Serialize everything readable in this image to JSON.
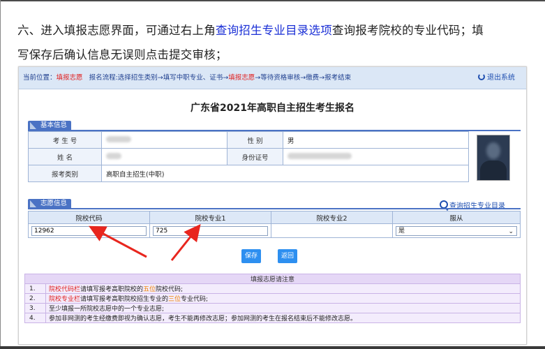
{
  "instruction": {
    "line1_a": "六、进入填报志愿界面，可通过右上角",
    "line1_link": "查询招生专业目录选项",
    "line1_b": "查询报考院校的专业代码；填",
    "line2": "写保存后确认信息无误则点击提交审核；"
  },
  "topbar": {
    "location_label": "当前位置：",
    "location_value": "填报志愿",
    "flow_a": "报名流程:选择招生类别→填写中职专业、证书→",
    "flow_current": "填报志愿",
    "flow_b": "→等待资格审核→缴费→报考结束",
    "logout": "退出系统"
  },
  "title": "广东省2021年高职自主招生考生报名",
  "basic": {
    "tab": "基本信息",
    "exam_no_label": "考 生 号",
    "gender_label": "性    别",
    "gender_value": "男",
    "name_label": "姓    名",
    "id_label": "身份证号",
    "category_label": "报考类别",
    "category_value": "高职自主招生(中职)"
  },
  "volunteer": {
    "tab": "志愿信息",
    "query_link": "查询招生专业目录",
    "headers": [
      "院校代码",
      "院校专业1",
      "院校专业2",
      "服从"
    ],
    "school_code": "12962",
    "major1": "725",
    "major2": "",
    "obey": "是"
  },
  "buttons": {
    "save": "保存",
    "back": "返回"
  },
  "notes": {
    "title": "填报志愿请注意",
    "items": [
      {
        "n": "1.",
        "a": "院校代码栏",
        "b": "请填写报考高职院校的",
        "c": "五位",
        "d": "院校代码;"
      },
      {
        "n": "2.",
        "a": "院校专业栏",
        "b": "请填写报考高职院校招生专业的",
        "c": "三位",
        "d": "专业代码;"
      },
      {
        "n": "3.",
        "text": "至少填报一所院校志愿中的一个专业志愿;"
      },
      {
        "n": "4.",
        "text": "参加非网测的考生经缴费即视为确认志愿，考生不能再修改志愿；参加网测的考生在报名结束后不能修改志愿。"
      }
    ]
  },
  "colors": {
    "accent": "#4a72c4",
    "link": "#1f4fb0",
    "highlight": "#1a2fd6",
    "arrow": "#e8261e",
    "button": "#2d8ff0"
  }
}
